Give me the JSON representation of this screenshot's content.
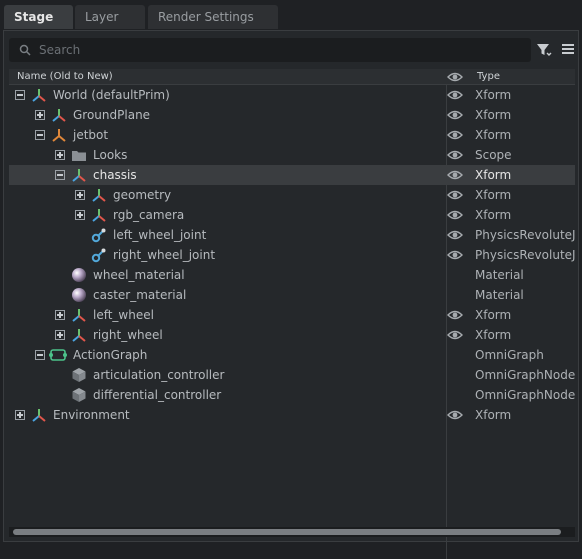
{
  "tabs": [
    {
      "label": "Stage"
    },
    {
      "label": "Layer"
    },
    {
      "label": "Render Settings"
    }
  ],
  "search": {
    "placeholder": "Search"
  },
  "columns": {
    "name": "Name (Old to New)",
    "type": "Type"
  },
  "rows": [
    {
      "label": "World (defaultPrim)",
      "type": "Xform"
    },
    {
      "label": "GroundPlane",
      "type": "Xform"
    },
    {
      "label": "jetbot",
      "type": "Xform"
    },
    {
      "label": "Looks",
      "type": "Scope"
    },
    {
      "label": "chassis",
      "type": "Xform"
    },
    {
      "label": "geometry",
      "type": "Xform"
    },
    {
      "label": "rgb_camera",
      "type": "Xform"
    },
    {
      "label": "left_wheel_joint",
      "type": "PhysicsRevoluteJoint"
    },
    {
      "label": "right_wheel_joint",
      "type": "PhysicsRevoluteJoint"
    },
    {
      "label": "wheel_material",
      "type": "Material"
    },
    {
      "label": "caster_material",
      "type": "Material"
    },
    {
      "label": "left_wheel",
      "type": "Xform"
    },
    {
      "label": "right_wheel",
      "type": "Xform"
    },
    {
      "label": "ActionGraph",
      "type": "OmniGraph"
    },
    {
      "label": "articulation_controller",
      "type": "OmniGraphNode"
    },
    {
      "label": "differential_controller",
      "type": "OmniGraphNode"
    },
    {
      "label": "Environment",
      "type": "Xform"
    }
  ],
  "colors": {
    "xform_red": "#e0564b",
    "xform_green": "#6ac16f",
    "xform_blue": "#4aa3e0",
    "jetbot_orange": "#e0873a",
    "joint_blue": "#52a8d9",
    "graph_green": "#4cc38a"
  }
}
